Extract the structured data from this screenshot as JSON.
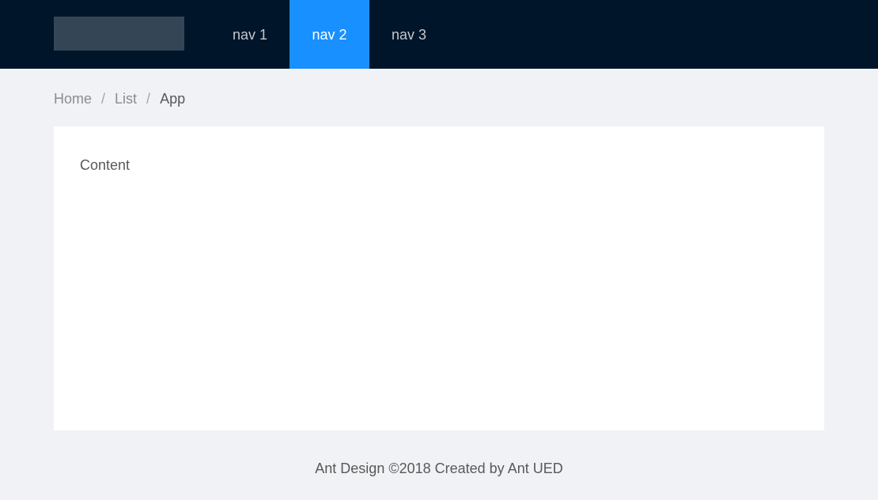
{
  "header": {
    "nav": [
      {
        "label": "nav 1",
        "active": false
      },
      {
        "label": "nav 2",
        "active": true
      },
      {
        "label": "nav 3",
        "active": false
      }
    ]
  },
  "breadcrumb": {
    "items": [
      "Home",
      "List",
      "App"
    ],
    "separator": "/"
  },
  "main": {
    "content_text": "Content"
  },
  "footer": {
    "text": "Ant Design ©2018 Created by Ant UED"
  },
  "colors": {
    "header_bg": "#001529",
    "accent": "#1890ff",
    "page_bg": "#f0f2f5"
  }
}
